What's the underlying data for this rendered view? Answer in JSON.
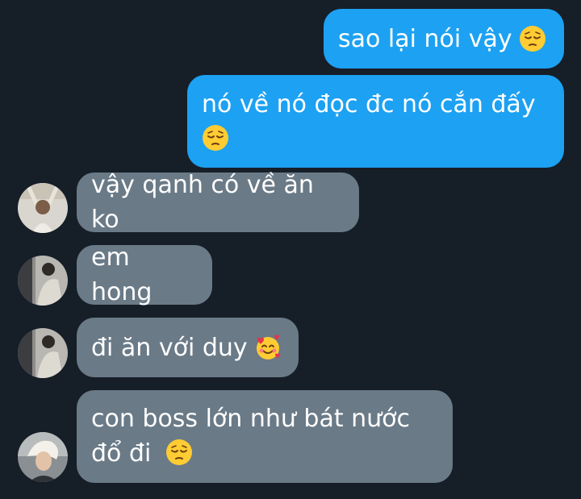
{
  "messages": {
    "m1": {
      "text": "sao lại nói vậy",
      "emoji": "pensive-face-emoji"
    },
    "m2": {
      "line1": "nó về nó đọc đc nó cắn đấy",
      "emoji": "pensive-face-emoji"
    },
    "m3": {
      "text": "vậy qanh có về ăn ko"
    },
    "m4": {
      "text": "em hong"
    },
    "m5": {
      "text": "đi ăn với duy",
      "emoji": "smiling-face-with-hearts-emoji"
    },
    "m6": {
      "line1": "con boss lớn như bát nước",
      "line2": "đổ đi",
      "emoji": "pensive-face-emoji"
    }
  },
  "colors": {
    "background": "#161e28",
    "outgoing_bubble": "#1da1f2",
    "incoming_bubble": "#6a7a87",
    "text": "#ffffff"
  }
}
